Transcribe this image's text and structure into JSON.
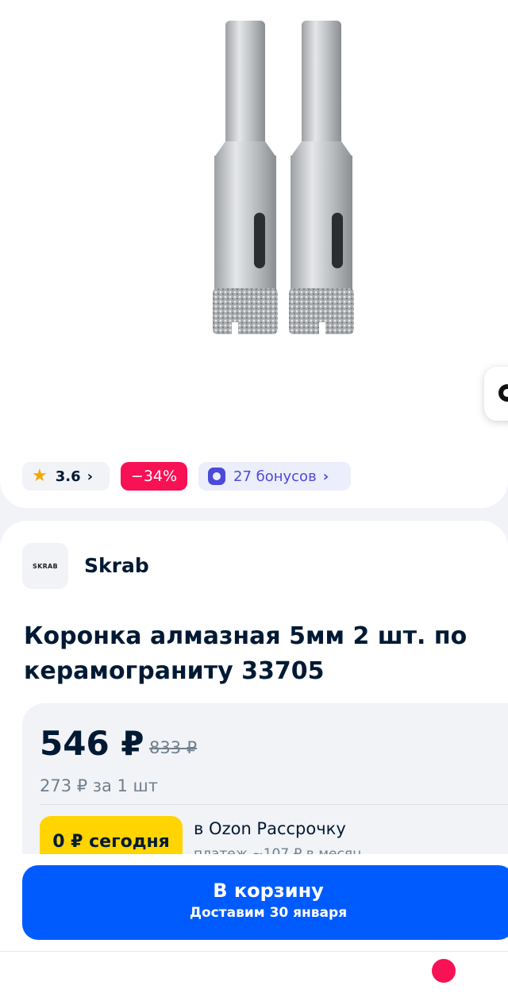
{
  "colors": {
    "primary": "#005bff",
    "discount": "#f91155",
    "bonus": "#4c4ad8",
    "badge_yellow": "#ffd400",
    "rating_star": "#f7a600"
  },
  "product_image": {
    "icon": "diamond-core-bits-image"
  },
  "chips": {
    "rating": "3.6",
    "discount": "−34%",
    "bonus": "27 бонусов"
  },
  "seller": {
    "logo_text": "SKRAB",
    "name": "Skrab"
  },
  "product": {
    "title": "Коронка алмазная 5мм 2 шт. по керамограниту 33705"
  },
  "price": {
    "current": "546 ₽",
    "old": "833 ₽",
    "per_unit": "273 ₽ за 1 шт"
  },
  "installment": {
    "badge": "0 ₽ сегодня",
    "title": "в Ozon Рассрочку",
    "subtitle": "платеж ~107 ₽ в месяц"
  },
  "cart_button": {
    "label": "В корзину",
    "delivery": "Доставим 30 января"
  }
}
